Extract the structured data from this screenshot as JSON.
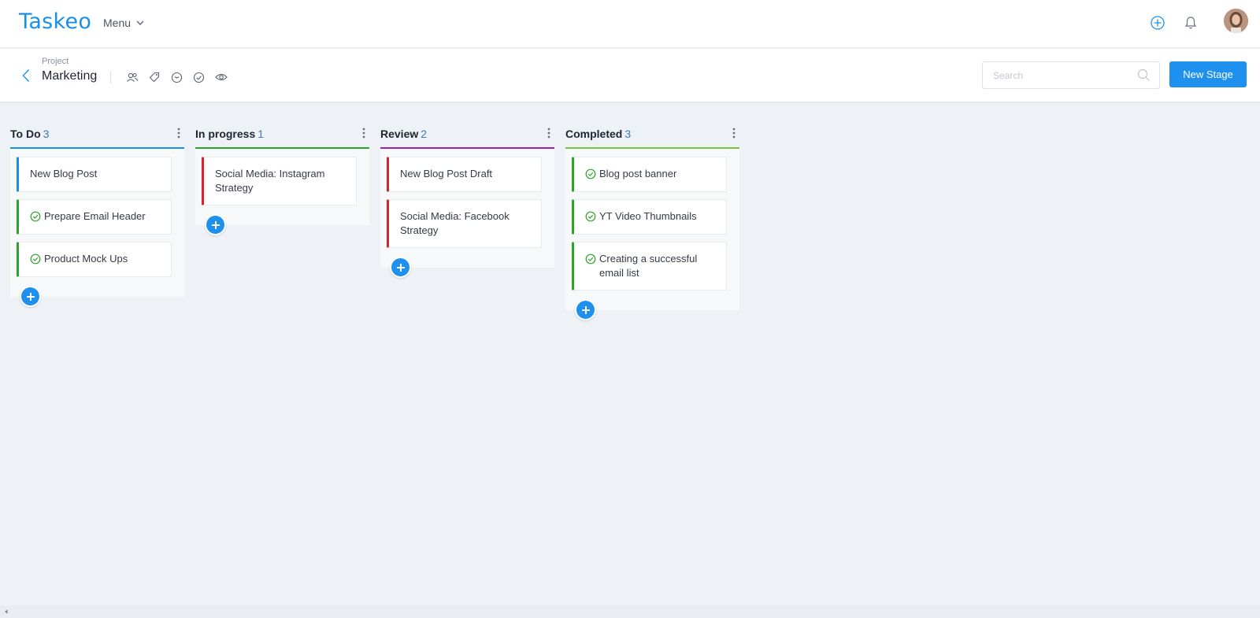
{
  "app": {
    "logo": "Taskeo",
    "menu_label": "Menu"
  },
  "header": {
    "icons": [
      "add-circle-icon",
      "bell-icon",
      "user-avatar"
    ]
  },
  "project": {
    "label": "Project",
    "name": "Marketing",
    "tools": [
      "users-icon",
      "tag-icon",
      "minus-circle-icon",
      "check-circle-icon",
      "eye-icon"
    ]
  },
  "search": {
    "placeholder": "Search"
  },
  "new_stage_label": "New Stage",
  "colors": {
    "primary": "#1e90ee",
    "todo": "#1a8fe6",
    "in_progress": "#2aa52a",
    "review": "#9a22b0",
    "completed": "#7ac142",
    "card_blue": "#1a8fe6",
    "card_green": "#2aa52a",
    "card_red": "#d9212b"
  },
  "columns": [
    {
      "title": "To Do",
      "count": "3",
      "cards": [
        {
          "text": "New Blog Post",
          "done": false,
          "accent": "blue"
        },
        {
          "text": "Prepare Email Header",
          "done": true,
          "accent": "green"
        },
        {
          "text": "Product Mock Ups",
          "done": true,
          "accent": "green"
        }
      ]
    },
    {
      "title": "In progress",
      "count": "1",
      "cards": [
        {
          "text": "Social Media: Instagram Strategy",
          "done": false,
          "accent": "red"
        }
      ]
    },
    {
      "title": "Review",
      "count": "2",
      "cards": [
        {
          "text": "New Blog Post Draft",
          "done": false,
          "accent": "red"
        },
        {
          "text": "Social Media: Facebook Strategy",
          "done": false,
          "accent": "red"
        }
      ]
    },
    {
      "title": "Completed",
      "count": "3",
      "cards": [
        {
          "text": "Blog post banner",
          "done": true,
          "accent": "green"
        },
        {
          "text": "YT Video Thumbnails",
          "done": true,
          "accent": "green"
        },
        {
          "text": "Creating a successful email list",
          "done": true,
          "accent": "green"
        }
      ]
    }
  ]
}
